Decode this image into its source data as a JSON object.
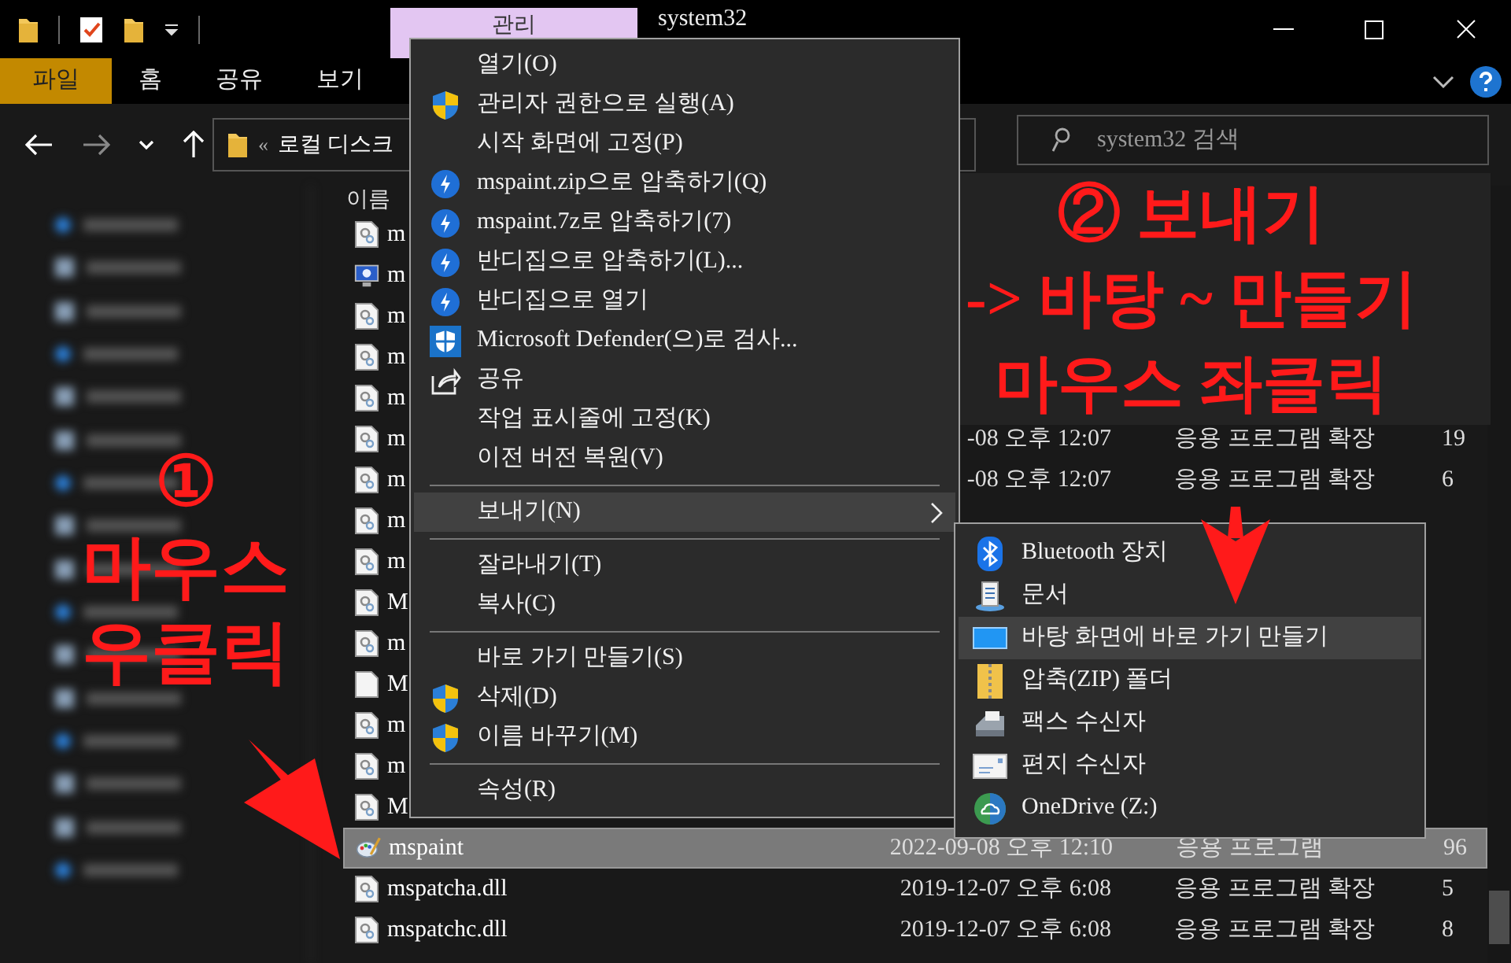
{
  "title_bar": {
    "context_tab": "관리",
    "title": "system32"
  },
  "ribbon_tabs": [
    {
      "label": "파일",
      "selected": true
    },
    {
      "label": "홈",
      "selected": false
    },
    {
      "label": "공유",
      "selected": false
    },
    {
      "label": "보기",
      "selected": false
    }
  ],
  "address_bar": {
    "prefix": "«",
    "path": "로컬 디스크"
  },
  "search": {
    "placeholder": "system32 검색"
  },
  "file_list": {
    "column_header": "이름",
    "rows": [
      {
        "kind": "dll",
        "name": "m",
        "selected": false
      },
      {
        "kind": "monitor",
        "name": "m",
        "selected": false
      },
      {
        "kind": "dll",
        "name": "m",
        "selected": false
      },
      {
        "kind": "dll",
        "name": "m",
        "selected": false
      },
      {
        "kind": "dll",
        "name": "m",
        "selected": false
      },
      {
        "kind": "dll",
        "name": "m",
        "date": "-08 오후 12:07",
        "type": "응용 프로그램 확장",
        "size": "19",
        "selected": false
      },
      {
        "kind": "dll",
        "name": "m",
        "date": "-08 오후 12:07",
        "type": "응용 프로그램 확장",
        "size": "6",
        "selected": false
      },
      {
        "kind": "dll",
        "name": "m",
        "selected": false
      },
      {
        "kind": "dll",
        "name": "m",
        "selected": false
      },
      {
        "kind": "dll",
        "name": "M",
        "selected": false
      },
      {
        "kind": "dll",
        "name": "m",
        "selected": false
      },
      {
        "kind": "blank",
        "name": "M",
        "selected": false
      },
      {
        "kind": "dll",
        "name": "m",
        "selected": false
      },
      {
        "kind": "dll",
        "name": "m",
        "selected": false
      },
      {
        "kind": "dll",
        "name": "M",
        "selected": false
      },
      {
        "kind": "paint",
        "name": "mspaint",
        "date": "2022-09-08 오후 12:10",
        "type": "응용 프로그램",
        "size": "96",
        "selected": true
      },
      {
        "kind": "dll",
        "name": "mspatcha.dll",
        "date": "2019-12-07 오후 6:08",
        "type": "응용 프로그램 확장",
        "size": "5",
        "selected": false
      },
      {
        "kind": "dll",
        "name": "mspatchc.dll",
        "date": "2019-12-07 오후 6:08",
        "type": "응용 프로그램 확장",
        "size": "8",
        "selected": false
      }
    ]
  },
  "context_menu": {
    "items": [
      {
        "kind": "plain",
        "label": "열기(O)",
        "selected": false,
        "submenu": false
      },
      {
        "kind": "shield",
        "label": "관리자 권한으로 실행(A)",
        "selected": false,
        "submenu": false
      },
      {
        "kind": "plain",
        "label": "시작 화면에 고정(P)",
        "selected": false,
        "submenu": false
      },
      {
        "kind": "bandizip",
        "label": "mspaint.zip으로 압축하기(Q)",
        "selected": false,
        "submenu": false
      },
      {
        "kind": "bandizip",
        "label": "mspaint.7z로 압축하기(7)",
        "selected": false,
        "submenu": false
      },
      {
        "kind": "bandizip",
        "label": "반디집으로 압축하기(L)...",
        "selected": false,
        "submenu": false
      },
      {
        "kind": "bandizip",
        "label": "반디집으로 열기",
        "selected": false,
        "submenu": false
      },
      {
        "kind": "defender",
        "label": "Microsoft Defender(으)로 검사...",
        "selected": false,
        "submenu": false
      },
      {
        "kind": "share",
        "label": "공유",
        "selected": false,
        "submenu": false
      },
      {
        "kind": "plain",
        "label": "작업 표시줄에 고정(K)",
        "selected": false,
        "submenu": false
      },
      {
        "kind": "plain",
        "label": "이전 버전 복원(V)",
        "selected": false,
        "submenu": false
      },
      {
        "kind": "separator"
      },
      {
        "kind": "plain",
        "label": "보내기(N)",
        "selected": true,
        "submenu": true
      },
      {
        "kind": "separator"
      },
      {
        "kind": "plain",
        "label": "잘라내기(T)",
        "selected": false,
        "submenu": false
      },
      {
        "kind": "plain",
        "label": "복사(C)",
        "selected": false,
        "submenu": false
      },
      {
        "kind": "separator"
      },
      {
        "kind": "plain",
        "label": "바로 가기 만들기(S)",
        "selected": false,
        "submenu": false
      },
      {
        "kind": "shield",
        "label": "삭제(D)",
        "selected": false,
        "submenu": false
      },
      {
        "kind": "shield",
        "label": "이름 바꾸기(M)",
        "selected": false,
        "submenu": false
      },
      {
        "kind": "separator"
      },
      {
        "kind": "plain",
        "label": "속성(R)",
        "selected": false,
        "submenu": false
      }
    ]
  },
  "send_to_menu": {
    "items": [
      {
        "kind": "bluetooth",
        "label": "Bluetooth 장치",
        "selected": false
      },
      {
        "kind": "document",
        "label": "문서",
        "selected": false
      },
      {
        "kind": "desktop",
        "label": "바탕 화면에 바로 가기 만들기",
        "selected": true
      },
      {
        "kind": "zip",
        "label": "압축(ZIP) 폴더",
        "selected": false
      },
      {
        "kind": "fax",
        "label": "팩스 수신자",
        "selected": false
      },
      {
        "kind": "mail",
        "label": "편지 수신자",
        "selected": false
      },
      {
        "kind": "onedrive",
        "label": "OneDrive (Z:)",
        "selected": false
      }
    ]
  },
  "annotations": [
    {
      "kind": "callout",
      "lines": [
        "①",
        "마우스",
        "우클릭"
      ]
    },
    {
      "kind": "boxed",
      "lines": [
        "② 보내기",
        "-> 바탕 ~ 만들기",
        "마우스 좌클릭"
      ]
    }
  ]
}
